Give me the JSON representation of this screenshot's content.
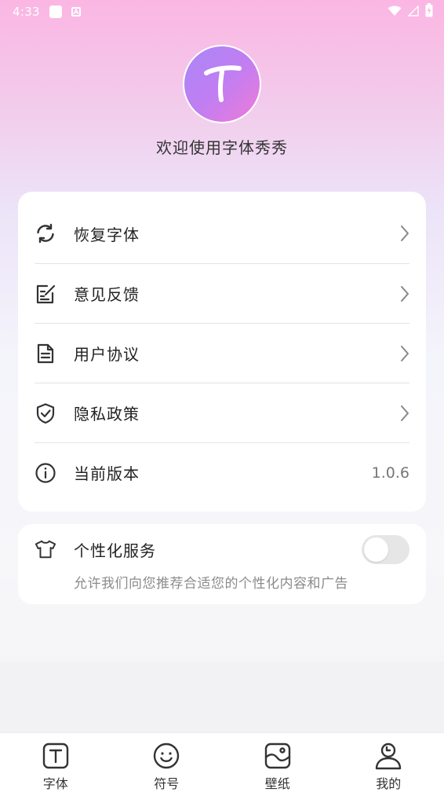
{
  "status_bar": {
    "time": "4:33",
    "icons": [
      "notification-square-icon",
      "app-a-icon",
      "wifi-icon",
      "signal-icon",
      "battery-charging-icon"
    ]
  },
  "header": {
    "avatar_letter": "T",
    "welcome": "欢迎使用字体秀秀"
  },
  "menu": {
    "items": [
      {
        "label": "恢复字体",
        "icon": "refresh-icon"
      },
      {
        "label": "意见反馈",
        "icon": "feedback-edit-icon"
      },
      {
        "label": "用户协议",
        "icon": "document-icon"
      },
      {
        "label": "隐私政策",
        "icon": "shield-check-icon"
      },
      {
        "label": "当前版本",
        "icon": "info-icon",
        "value": "1.0.6"
      }
    ]
  },
  "service": {
    "label": "个性化服务",
    "description": "允许我们向您推荐合适您的个性化内容和广告",
    "icon": "tshirt-icon",
    "enabled": false
  },
  "tabs": [
    {
      "label": "字体",
      "icon": "font-t-icon"
    },
    {
      "label": "符号",
      "icon": "smiley-icon"
    },
    {
      "label": "壁纸",
      "icon": "wallpaper-image-icon"
    },
    {
      "label": "我的",
      "icon": "person-icon"
    }
  ],
  "colors": {
    "avatar_gradient_start": "#a987f7",
    "avatar_gradient_end": "#ef7ad8",
    "toggle_off": "#e6e6e6"
  }
}
